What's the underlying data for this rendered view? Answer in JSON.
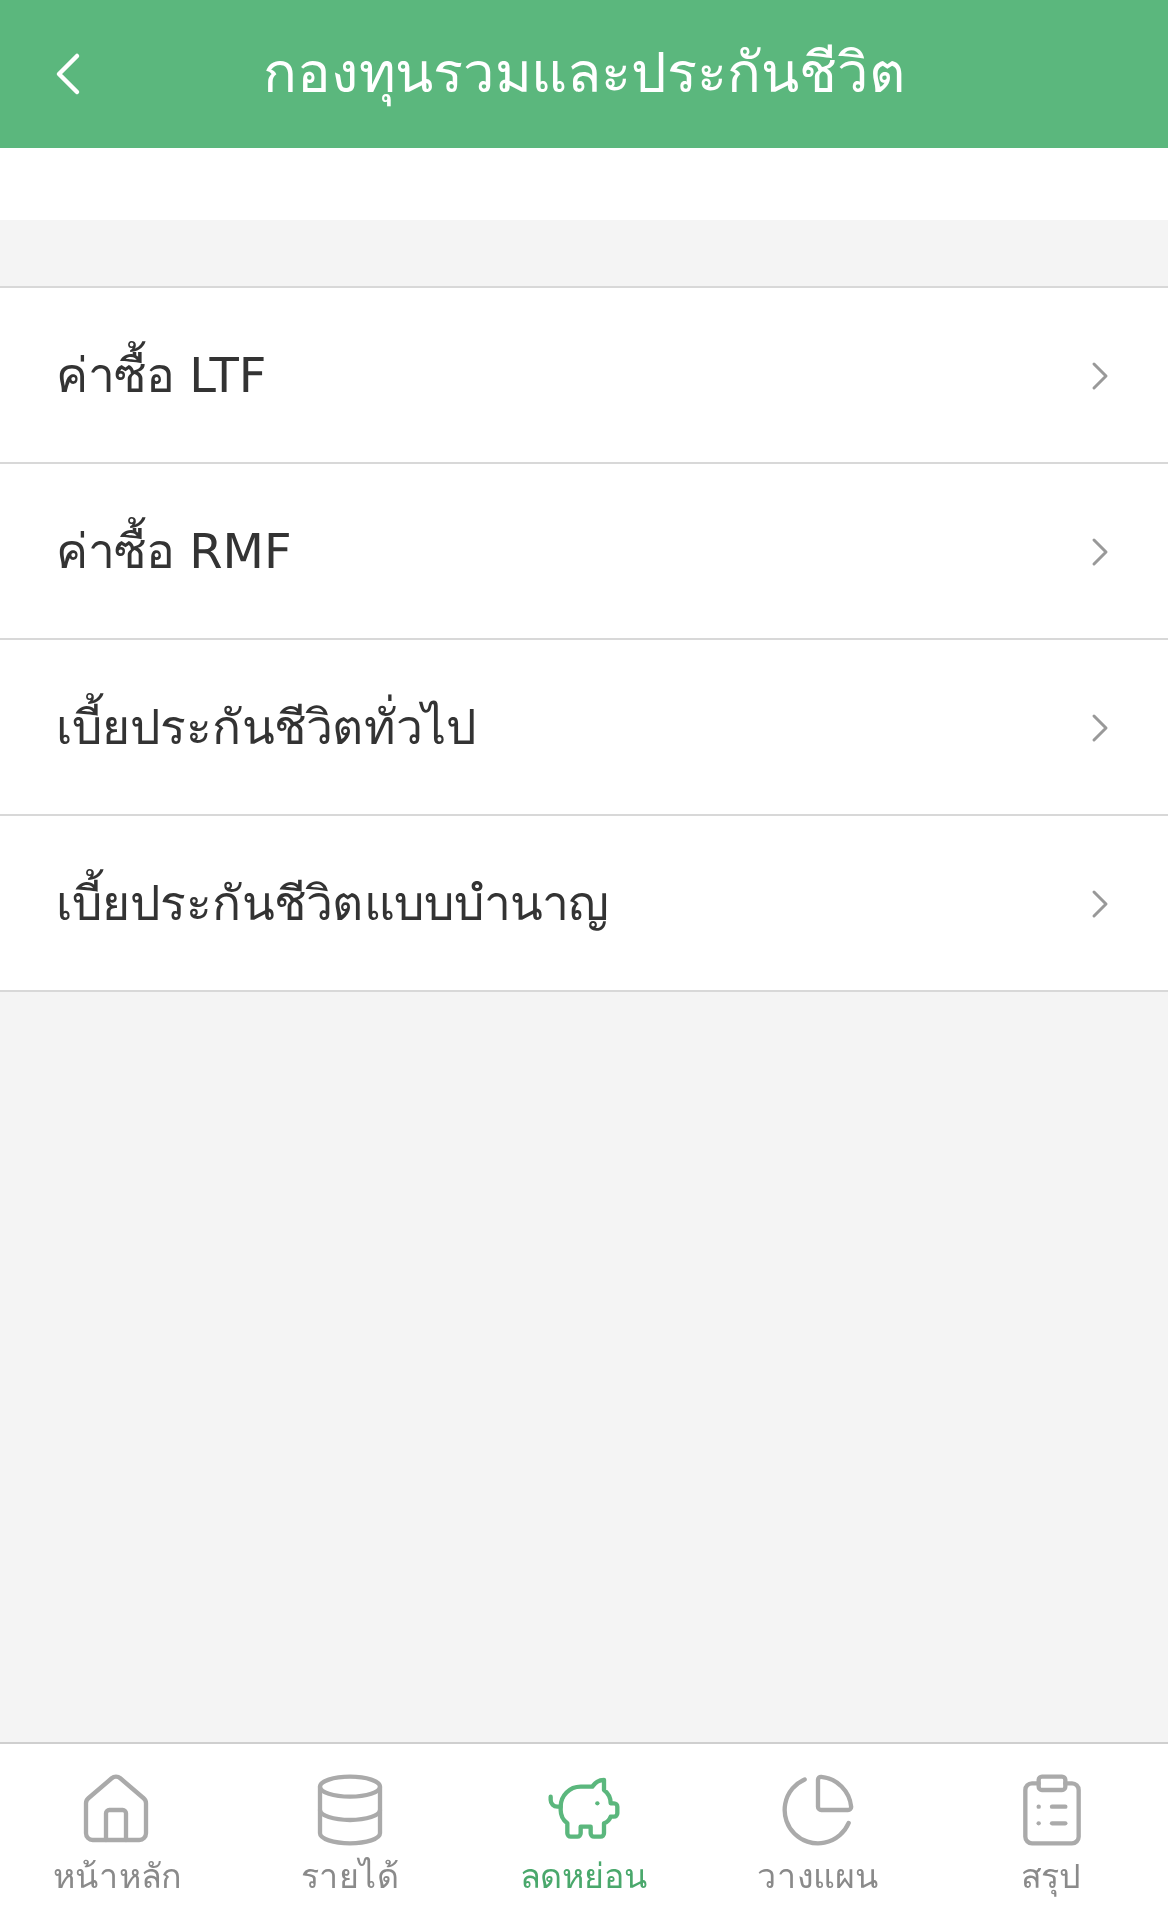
{
  "header": {
    "title": "กองทุนรวมและประกันชีวิต"
  },
  "items": [
    {
      "label": "ค่าซื้อ LTF"
    },
    {
      "label": "ค่าซื้อ RMF"
    },
    {
      "label": "เบี้ยประกันชีวิตทั่วไป"
    },
    {
      "label": "เบี้ยประกันชีวิตแบบบำนาญ"
    }
  ],
  "tabs": [
    {
      "kind": "home",
      "label": "หน้าหลัก",
      "selected": false
    },
    {
      "kind": "coins",
      "label": "รายได้",
      "selected": false
    },
    {
      "kind": "piggy",
      "label": "ลดหย่อน",
      "selected": true
    },
    {
      "kind": "pie",
      "label": "วางแผน",
      "selected": false
    },
    {
      "kind": "clipboard",
      "label": "สรุป",
      "selected": false
    }
  ]
}
